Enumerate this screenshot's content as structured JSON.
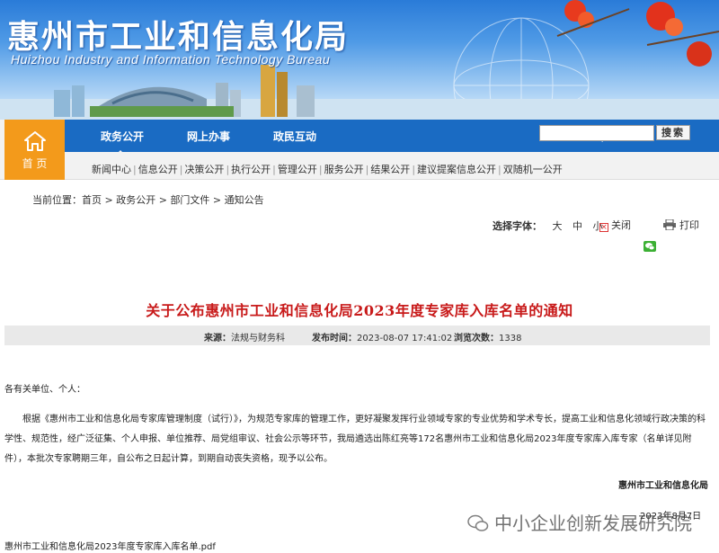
{
  "banner": {
    "title_cn": "惠州市工业和信息化局",
    "title_en": "Huizhou Industry and Information Technology Bureau"
  },
  "nav": {
    "home_label": "首 页",
    "main_items": [
      "政务公开",
      "网上办事",
      "政民互动"
    ],
    "search_placeholder": "",
    "search_button": "搜索",
    "sub_items": [
      "新闻中心",
      "信息公开",
      "决策公开",
      "执行公开",
      "管理公开",
      "服务公开",
      "结果公开",
      "建议提案信息公开",
      "双随机一公开"
    ]
  },
  "breadcrumb": {
    "prefix": "当前位置：",
    "items": [
      "首页",
      "政务公开",
      "部门文件",
      "通知公告"
    ],
    "separator": " > "
  },
  "tools": {
    "font_label": "选择字体：",
    "font_sizes": [
      "大",
      "中",
      "小"
    ],
    "close_label": "关闭",
    "print_label": "打印"
  },
  "article": {
    "title": "关于公布惠州市工业和信息化局2023年度专家库入库名单的通知",
    "source_label": "来源：",
    "source": "法规与财务科",
    "date_label": "发布时间：",
    "date": "2023-08-07 17:41:02",
    "views_label": "浏览次数：",
    "views": "1338",
    "greeting": "各有关单位、个人：",
    "paragraph": "根据《惠州市工业和信息化局专家库管理制度（试行）》，为规范专家库的管理工作，更好凝聚发挥行业领域专家的专业优势和学术专长，提高工业和信息化领域行政决策的科学性、规范性，经广泛征集、个人申报、单位推荐、局党组审议、社会公示等环节，我局遴选出陈红亮等172名惠州市工业和信息化局2023年度专家库入库专家（名单详见附件），本批次专家聘期三年，自公布之日起计算，到期自动丧失资格，现予以公布。",
    "signer": "惠州市工业和信息化局",
    "sign_date": "2023年8月7日",
    "attachment": "惠州市工业和信息化局2023年度专家库入库名单.pdf"
  },
  "watermark": "中小企业创新发展研究院",
  "colors": {
    "nav_blue": "#1a6bc3",
    "home_orange": "#f39a1b",
    "title_red": "#c81a1a"
  }
}
